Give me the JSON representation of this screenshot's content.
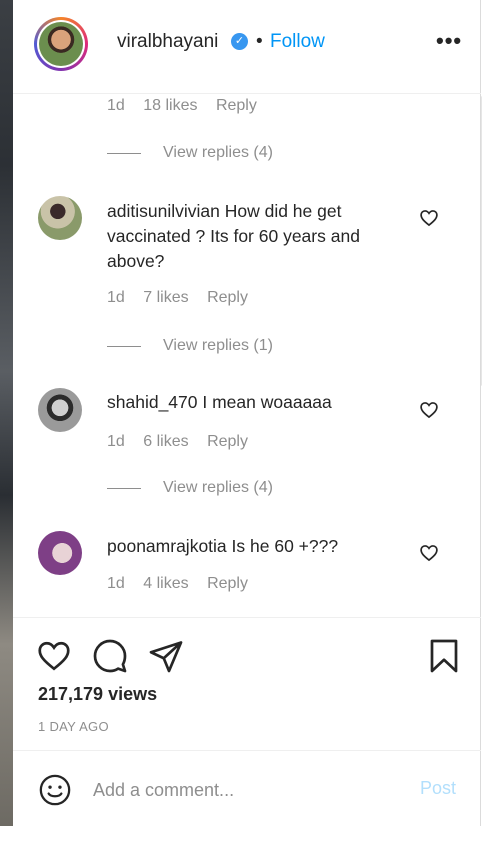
{
  "header": {
    "username": "viralbhayani",
    "separator": "•",
    "follow_label": "Follow",
    "more_label": "•••"
  },
  "top_meta": {
    "time": "1d",
    "likes": "18 likes",
    "reply": "Reply"
  },
  "top_view_replies": "View replies (4)",
  "comments": [
    {
      "username": "aditisunilvivian",
      "text": "How did he get vaccinated ? Its for 60 years and above?",
      "time": "1d",
      "likes": "7 likes",
      "reply": "Reply",
      "view_replies": "View replies (1)"
    },
    {
      "username": "shahid_470",
      "text": "I mean woaaaaa",
      "time": "1d",
      "likes": "6 likes",
      "reply": "Reply",
      "view_replies": "View replies (4)"
    },
    {
      "username": "poonamrajkotia",
      "text": "Is he 60 +???",
      "time": "1d",
      "likes": "4 likes",
      "reply": "Reply"
    }
  ],
  "actions": {
    "views": "217,179 views",
    "time_ago": "1 DAY AGO"
  },
  "comment_box": {
    "placeholder": "Add a comment...",
    "post_label": "Post"
  },
  "icons": [
    "more-options-icon",
    "verified-badge-icon",
    "heart-icon",
    "comment-icon",
    "share-icon",
    "bookmark-icon",
    "emoji-icon"
  ],
  "colors": {
    "link_blue": "#0095f6",
    "post_disabled": "#b2dffc",
    "muted": "#8e8e8e",
    "verified": "#3897f0"
  }
}
